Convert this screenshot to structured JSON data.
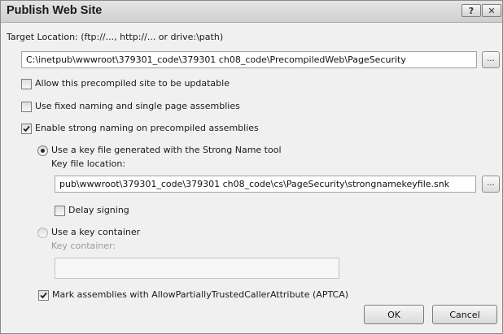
{
  "window": {
    "title": "Publish Web Site",
    "help_glyph": "?",
    "close_glyph": "✕"
  },
  "target": {
    "label": "Target Location: (ftp://..., http://... or drive:\\path)",
    "value": "C:\\inetpub\\wwwroot\\379301_code\\379301 ch08_code\\PrecompiledWeb\\PageSecurity",
    "browse_label": "..."
  },
  "options": {
    "updatable": {
      "label": "Allow this precompiled site to be updatable",
      "checked": false
    },
    "fixed_naming": {
      "label": "Use fixed naming and single page assemblies",
      "checked": false
    },
    "strong_naming": {
      "label": "Enable strong naming on precompiled assemblies",
      "checked": true
    }
  },
  "key_file": {
    "radio_label": "Use a key file generated with the Strong Name tool",
    "selected": true,
    "location_label": "Key file location:",
    "location_value": "pub\\wwwroot\\379301_code\\379301 ch08_code\\cs\\PageSecurity\\strongnamekeyfile.snk",
    "browse_label": "...",
    "delay_signing": {
      "label": "Delay signing",
      "checked": false
    }
  },
  "key_container": {
    "radio_label": "Use a key container",
    "selected": false,
    "label": "Key container:",
    "value": ""
  },
  "aptca": {
    "label": "Mark assemblies with AllowPartiallyTrustedCallerAttribute (APTCA)",
    "checked": true
  },
  "buttons": {
    "ok": "OK",
    "cancel": "Cancel"
  }
}
